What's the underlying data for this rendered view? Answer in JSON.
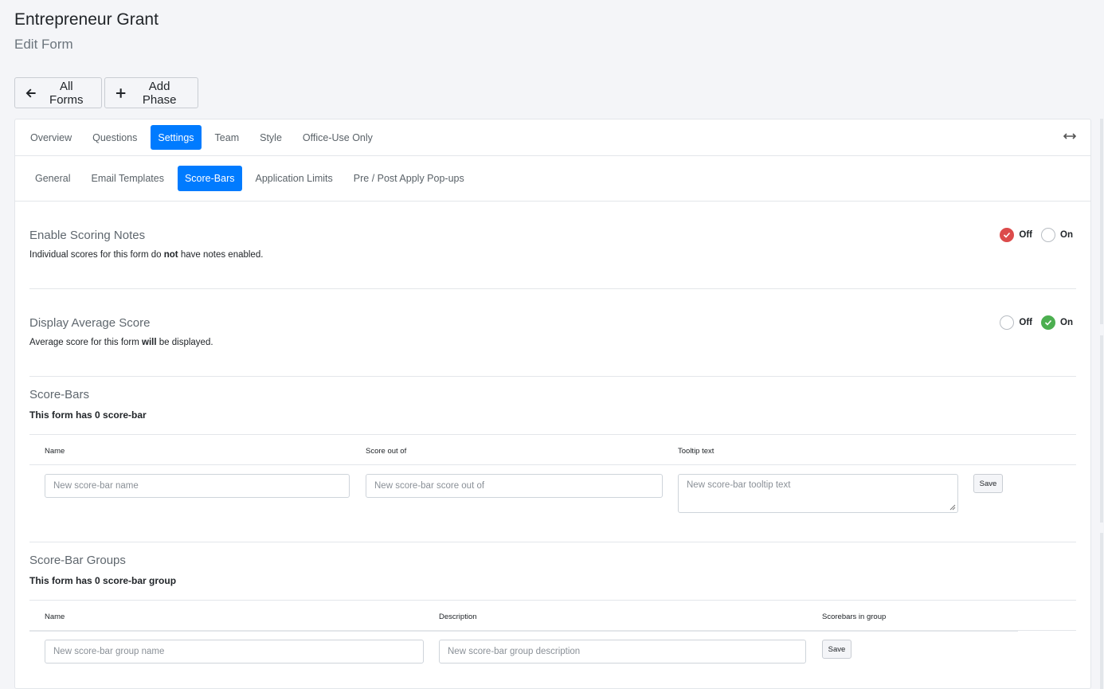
{
  "header": {
    "title": "Entrepreneur Grant",
    "subtitle": "Edit Form"
  },
  "toolbar": {
    "all_forms": "All Forms",
    "add_phase": "Add Phase"
  },
  "main_tabs": [
    {
      "label": "Overview",
      "active": false
    },
    {
      "label": "Questions",
      "active": false
    },
    {
      "label": "Settings",
      "active": true
    },
    {
      "label": "Team",
      "active": false
    },
    {
      "label": "Style",
      "active": false
    },
    {
      "label": "Office-Use Only",
      "active": false
    }
  ],
  "sub_tabs": [
    {
      "label": "General",
      "active": false
    },
    {
      "label": "Email Templates",
      "active": false
    },
    {
      "label": "Score-Bars",
      "active": true
    },
    {
      "label": "Application Limits",
      "active": false
    },
    {
      "label": "Pre / Post Apply Pop-ups",
      "active": false
    }
  ],
  "scoring_notes": {
    "title": "Enable Scoring Notes",
    "desc_before": "Individual scores for this form do ",
    "desc_bold": "not",
    "desc_after": " have notes enabled.",
    "off_label": "Off",
    "on_label": "On",
    "selected": "Off"
  },
  "average_score": {
    "title": "Display Average Score",
    "desc_before": "Average score for this form ",
    "desc_bold": "will",
    "desc_after": " be displayed.",
    "off_label": "Off",
    "on_label": "On",
    "selected": "On"
  },
  "score_bars": {
    "title": "Score-Bars",
    "count_text": "This form has 0 score-bar",
    "columns": [
      "Name",
      "Score out of",
      "Tooltip text"
    ],
    "name_placeholder": "New score-bar name",
    "score_placeholder": "New score-bar score out of",
    "tooltip_placeholder": "New score-bar tooltip text",
    "save_label": "Save"
  },
  "score_bar_groups": {
    "title": "Score-Bar Groups",
    "count_text": "This form has 0 score-bar group",
    "columns": [
      "Name",
      "Description",
      "Scorebars in group"
    ],
    "name_placeholder": "New score-bar group name",
    "description_placeholder": "New score-bar group description",
    "save_label": "Save"
  },
  "colors": {
    "accent": "#007bff",
    "off_selected": "#dc4b4b",
    "on_selected": "#4caf50"
  }
}
